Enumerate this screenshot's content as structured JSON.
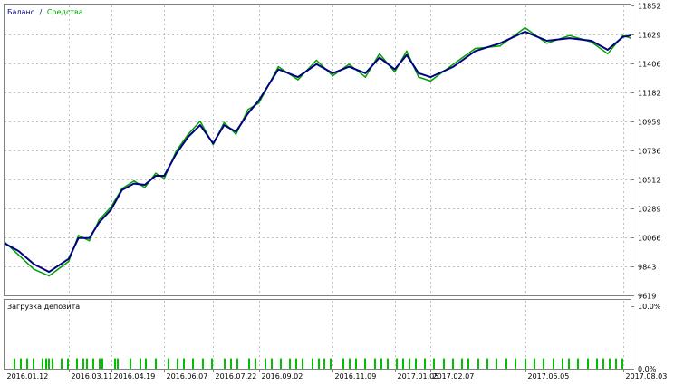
{
  "legend": {
    "balance": {
      "label": "Баланс",
      "color": "#000080"
    },
    "separator": "/",
    "equity": {
      "label": "Средства",
      "color": "#00a000"
    }
  },
  "sub_panel_title": "Загрузка депозита",
  "colors": {
    "grid": "#c0c0c0",
    "frame": "#808080",
    "background": "#ffffff",
    "load_bar": "#00c000"
  },
  "chart_data": [
    {
      "type": "line",
      "grid": true,
      "legend_position": "top-left",
      "y_axis_position": "right",
      "yticks": [
        9619,
        9843,
        10066,
        10289,
        10512,
        10736,
        10959,
        11182,
        11406,
        11629,
        11852
      ],
      "ylim": [
        9619,
        11852
      ],
      "xticks": [
        "2016.01.12",
        "2016.03.11",
        "2016.04.19",
        "2016.06.07",
        "2016.07.22",
        "2016.09.02",
        "2016.11.09",
        "2017.01.05",
        "2017.02.07",
        "2017.05.05",
        "2017.08.03"
      ],
      "x": [
        "2016.01.12",
        "2016.01.25",
        "2016.02.08",
        "2016.02.22",
        "2016.03.11",
        "2016.03.20",
        "2016.03.30",
        "2016.04.08",
        "2016.04.19",
        "2016.04.29",
        "2016.05.10",
        "2016.05.20",
        "2016.05.30",
        "2016.06.07",
        "2016.06.18",
        "2016.06.29",
        "2016.07.10",
        "2016.07.22",
        "2016.08.01",
        "2016.08.12",
        "2016.08.23",
        "2016.09.02",
        "2016.09.20",
        "2016.10.08",
        "2016.10.25",
        "2016.11.09",
        "2016.11.24",
        "2016.12.09",
        "2016.12.22",
        "2017.01.05",
        "2017.01.16",
        "2017.01.27",
        "2017.02.07",
        "2017.02.28",
        "2017.03.20",
        "2017.04.12",
        "2017.05.05",
        "2017.05.25",
        "2017.06.15",
        "2017.07.05",
        "2017.07.20",
        "2017.08.03",
        "2017.08.10"
      ],
      "series": [
        {
          "name": "Баланс",
          "color": "#000080",
          "values": [
            10020,
            9960,
            9860,
            9800,
            9900,
            10060,
            10060,
            10180,
            10280,
            10430,
            10480,
            10470,
            10540,
            10540,
            10710,
            10840,
            10930,
            10790,
            10930,
            10880,
            11020,
            11120,
            11360,
            11300,
            11400,
            11330,
            11380,
            11330,
            11450,
            11360,
            11470,
            11330,
            11300,
            11380,
            11500,
            11560,
            11650,
            11580,
            11600,
            11580,
            11510,
            11610,
            11620
          ]
        },
        {
          "name": "Средства",
          "color": "#00a000",
          "values": [
            10030,
            9930,
            9820,
            9770,
            9880,
            10080,
            10040,
            10200,
            10300,
            10440,
            10500,
            10450,
            10560,
            10520,
            10730,
            10860,
            10960,
            10780,
            10950,
            10860,
            11050,
            11100,
            11380,
            11280,
            11430,
            11310,
            11400,
            11300,
            11480,
            11340,
            11500,
            11300,
            11270,
            11400,
            11520,
            11540,
            11680,
            11560,
            11620,
            11570,
            11480,
            11620,
            11600
          ]
        }
      ]
    },
    {
      "type": "bar",
      "title": "Загрузка депозита",
      "ylim": [
        0,
        10
      ],
      "y_unit": "%",
      "yticks": [
        "10.0%",
        "0.0%"
      ],
      "grid": true,
      "bar_color": "#00c000",
      "bar_date_fractions": [
        0.015,
        0.025,
        0.035,
        0.045,
        0.06,
        0.065,
        0.07,
        0.075,
        0.09,
        0.1,
        0.115,
        0.125,
        0.13,
        0.14,
        0.15,
        0.155,
        0.175,
        0.18,
        0.2,
        0.215,
        0.225,
        0.24,
        0.26,
        0.275,
        0.285,
        0.3,
        0.315,
        0.33,
        0.35,
        0.36,
        0.37,
        0.39,
        0.4,
        0.415,
        0.425,
        0.44,
        0.455,
        0.465,
        0.475,
        0.49,
        0.5,
        0.51,
        0.52,
        0.54,
        0.55,
        0.56,
        0.575,
        0.59,
        0.6,
        0.61,
        0.625,
        0.635,
        0.645,
        0.655,
        0.67,
        0.685,
        0.7,
        0.715,
        0.73,
        0.74,
        0.755,
        0.77,
        0.785,
        0.8,
        0.815,
        0.83,
        0.845,
        0.86,
        0.875,
        0.89,
        0.9,
        0.915,
        0.93,
        0.945,
        0.955,
        0.965,
        0.975,
        0.985
      ],
      "values": [
        1.6,
        1.6,
        1.6,
        1.6,
        1.6,
        1.6,
        1.6,
        1.6,
        1.6,
        1.6,
        1.6,
        1.6,
        1.6,
        1.6,
        1.6,
        1.6,
        1.6,
        1.6,
        1.6,
        1.6,
        1.6,
        1.6,
        1.6,
        1.6,
        1.6,
        1.6,
        1.6,
        1.6,
        1.6,
        1.6,
        1.6,
        1.6,
        1.6,
        1.6,
        1.6,
        1.6,
        1.6,
        1.6,
        1.6,
        1.6,
        1.6,
        1.6,
        1.6,
        1.6,
        1.6,
        1.6,
        1.6,
        1.6,
        1.6,
        1.6,
        1.6,
        1.6,
        1.6,
        1.6,
        1.6,
        1.6,
        1.6,
        1.6,
        1.6,
        1.6,
        1.6,
        1.6,
        1.6,
        1.6,
        1.6,
        1.6,
        1.6,
        1.6,
        1.6,
        1.6,
        1.6,
        1.6,
        1.6,
        1.6,
        1.6,
        1.6,
        1.6,
        1.6
      ]
    }
  ]
}
